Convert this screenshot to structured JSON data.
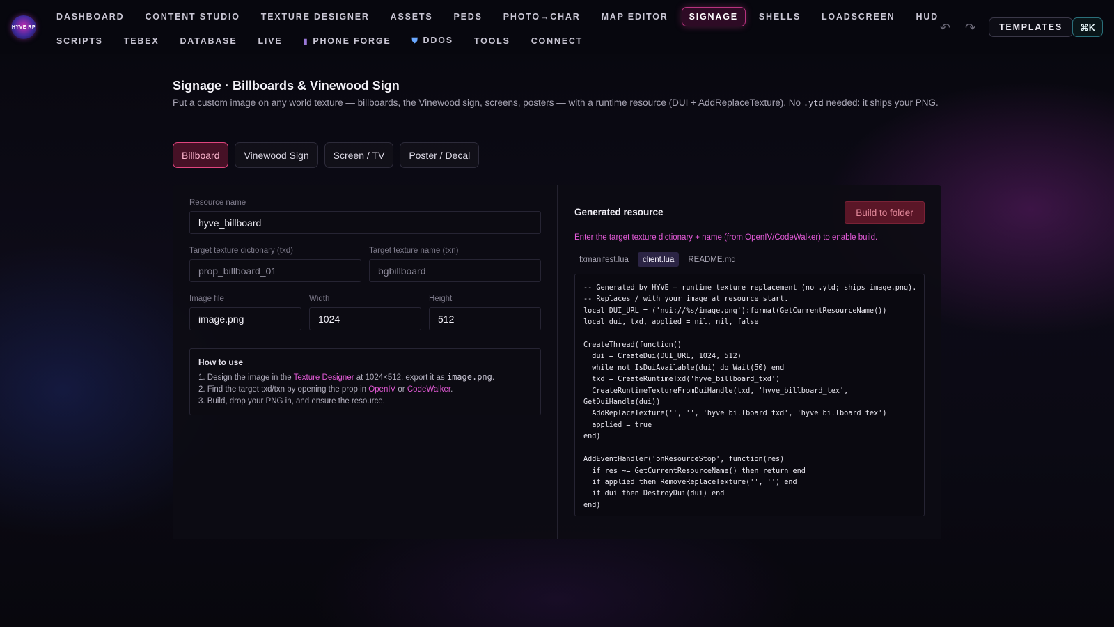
{
  "app": {
    "logo_text": "HYVE RP"
  },
  "nav": {
    "row1": [
      {
        "label": "DASHBOARD"
      },
      {
        "label": "CONTENT STUDIO"
      },
      {
        "label": "TEXTURE DESIGNER"
      },
      {
        "label": "ASSETS"
      },
      {
        "label": "PEDS"
      },
      {
        "label": "PHOTO→CHAR"
      },
      {
        "label": "MAP EDITOR"
      },
      {
        "label": "SIGNAGE",
        "active": true
      },
      {
        "label": "SHELLS"
      },
      {
        "label": "LOADSCREEN"
      },
      {
        "label": "HUD"
      }
    ],
    "row2": [
      {
        "label": "SCRIPTS"
      },
      {
        "label": "TEBEX"
      },
      {
        "label": "DATABASE"
      },
      {
        "label": "LIVE"
      },
      {
        "label": "PHONE FORGE",
        "icon": "phone-icon"
      },
      {
        "label": "DDOS",
        "icon": "shield-icon"
      },
      {
        "label": "TOOLS"
      },
      {
        "label": "CONNECT"
      }
    ],
    "templates_label": "TEMPLATES",
    "command_label": "⌘K"
  },
  "page": {
    "title": "Signage · Billboards & Vinewood Sign",
    "desc_before": "Put a custom image on any world texture — billboards, the Vinewood sign, screens, posters — with a runtime resource (DUI + AddReplaceTexture). No ",
    "desc_code": ".ytd",
    "desc_after": " needed: it ships your PNG."
  },
  "tabs": [
    {
      "label": "Billboard",
      "active": true
    },
    {
      "label": "Vinewood Sign"
    },
    {
      "label": "Screen / TV"
    },
    {
      "label": "Poster / Decal"
    }
  ],
  "form": {
    "resource_name": {
      "label": "Resource name",
      "value": "hyve_billboard"
    },
    "txd": {
      "label": "Target texture dictionary (txd)",
      "placeholder": "prop_billboard_01"
    },
    "txn": {
      "label": "Target texture name (txn)",
      "placeholder": "bgbillboard"
    },
    "image_file": {
      "label": "Image file",
      "value": "image.png"
    },
    "width": {
      "label": "Width",
      "value": "1024"
    },
    "height": {
      "label": "Height",
      "value": "512"
    }
  },
  "how_to": {
    "title": "How to use",
    "step1_a": "1. Design the image in the ",
    "step1_link": "Texture Designer",
    "step1_b": " at 1024×512, export it as ",
    "step1_code": "image.png",
    "step1_c": ".",
    "step2_a": "2. Find the target txd/txn by opening the prop in ",
    "step2_link1": "OpenIV",
    "step2_or": " or ",
    "step2_link2": "CodeWalker",
    "step2_c": ".",
    "step3": "3. Build, drop your PNG in, and ensure the resource."
  },
  "generated": {
    "title": "Generated resource",
    "build_label": "Build to folder",
    "warning": "Enter the target texture dictionary + name (from OpenIV/CodeWalker) to enable build.",
    "files": [
      {
        "label": "fxmanifest.lua"
      },
      {
        "label": "client.lua",
        "active": true
      },
      {
        "label": "README.md"
      }
    ],
    "code": "-- Generated by HYVE — runtime texture replacement (no .ytd; ships image.png).\n-- Replaces / with your image at resource start.\nlocal DUI_URL = ('nui://%s/image.png'):format(GetCurrentResourceName())\nlocal dui, txd, applied = nil, nil, false\n\nCreateThread(function()\n  dui = CreateDui(DUI_URL, 1024, 512)\n  while not IsDuiAvailable(dui) do Wait(50) end\n  txd = CreateRuntimeTxd('hyve_billboard_txd')\n  CreateRuntimeTextureFromDuiHandle(txd, 'hyve_billboard_tex',\nGetDuiHandle(dui))\n  AddReplaceTexture('', '', 'hyve_billboard_txd', 'hyve_billboard_tex')\n  applied = true\nend)\n\nAddEventHandler('onResourceStop', function(res)\n  if res ~= GetCurrentResourceName() then return end\n  if applied then RemoveReplaceTexture('', '') end\n  if dui then DestroyDui(dui) end\nend)"
  }
}
